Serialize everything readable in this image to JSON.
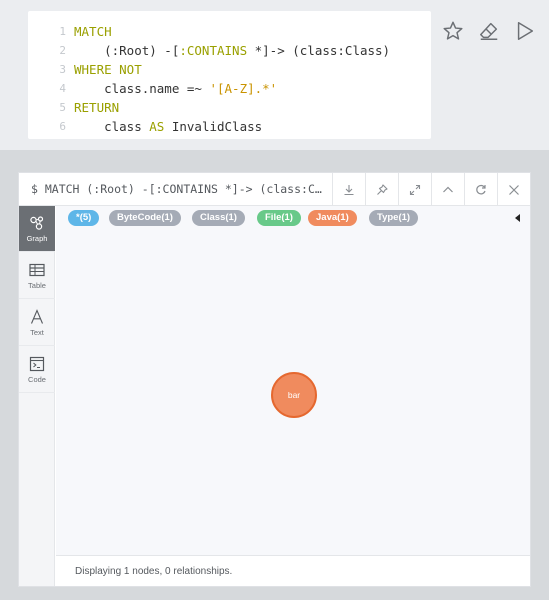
{
  "editor": {
    "lines": [
      {
        "num": "1",
        "segs": [
          {
            "t": "MATCH",
            "c": "kw"
          }
        ]
      },
      {
        "num": "2",
        "segs": [
          {
            "t": "    (:Root) -[",
            "c": ""
          },
          {
            "t": ":CONTAINS",
            "c": "label"
          },
          {
            "t": " *]-> (class:Class)",
            "c": ""
          }
        ]
      },
      {
        "num": "3",
        "segs": [
          {
            "t": "WHERE NOT",
            "c": "kw"
          }
        ]
      },
      {
        "num": "4",
        "segs": [
          {
            "t": "    class.name =~ ",
            "c": ""
          },
          {
            "t": "'[A-Z].*'",
            "c": "str"
          }
        ]
      },
      {
        "num": "5",
        "segs": [
          {
            "t": "RETURN",
            "c": "kw"
          }
        ]
      },
      {
        "num": "6",
        "segs": [
          {
            "t": "    class ",
            "c": ""
          },
          {
            "t": "AS",
            "c": "kw"
          },
          {
            "t": " InvalidClass",
            "c": ""
          }
        ]
      }
    ],
    "actions": [
      "star-icon",
      "eraser-icon",
      "play-icon"
    ]
  },
  "frame": {
    "title": "$ MATCH (:Root) -[:CONTAINS *]-> (class:Class) WHERE NOT class.name =~ '[A-Z].*' RETURN class AS InvalidClass",
    "header_buttons": [
      "download-icon",
      "pin-icon",
      "expand-icon",
      "chevron-up-icon",
      "refresh-icon",
      "close-icon"
    ]
  },
  "sidebar": {
    "tabs": [
      {
        "label": "Graph",
        "icon": "graph-icon",
        "active": true
      },
      {
        "label": "Table",
        "icon": "table-icon",
        "active": false
      },
      {
        "label": "Text",
        "icon": "text-icon",
        "active": false
      },
      {
        "label": "Code",
        "icon": "code-icon",
        "active": false
      }
    ]
  },
  "legend": {
    "pills": [
      {
        "text": "*(5)",
        "color": "#5eb6e8"
      },
      {
        "text": "ByteCode(1)",
        "color": "#a5abb6"
      },
      {
        "text": "Class(1)",
        "color": "#a5abb6"
      },
      {
        "text": "File(1)",
        "color": "#68c989"
      },
      {
        "text": "Java(1)",
        "color": "#f08b5e"
      },
      {
        "text": "Type(1)",
        "color": "#a5abb6"
      }
    ]
  },
  "graph": {
    "node": {
      "label": "bar",
      "fill": "#f08b5e",
      "border": "#e5682f"
    }
  },
  "status": {
    "text": "Displaying 1 nodes, 0 relationships."
  }
}
